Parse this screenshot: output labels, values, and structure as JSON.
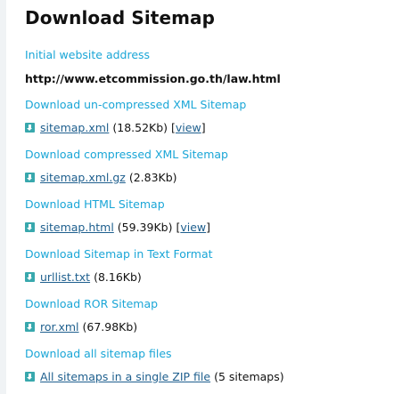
{
  "page": {
    "title": "Download Sitemap",
    "initial_label": "Initial website address",
    "initial_url": "http://www.etcommission.go.th/law.html"
  },
  "sections": [
    {
      "heading": "Download un-compressed XML Sitemap",
      "file": "sitemap.xml",
      "size": "(18.52Kb)",
      "view_open": "[",
      "view_label": "view",
      "view_close": "]"
    },
    {
      "heading": "Download compressed XML Sitemap",
      "file": "sitemap.xml.gz",
      "size": "(2.83Kb)"
    },
    {
      "heading": "Download HTML Sitemap",
      "file": "sitemap.html",
      "size": "(59.39Kb)",
      "view_open": "[",
      "view_label": "view",
      "view_close": "]"
    },
    {
      "heading": "Download Sitemap in Text Format",
      "file": "urllist.txt",
      "size": "(8.16Kb)"
    },
    {
      "heading": "Download ROR Sitemap",
      "file": "ror.xml",
      "size": "(67.98Kb)"
    },
    {
      "heading": "Download all sitemap files",
      "file": "All sitemaps in a single ZIP file",
      "size": "(5 sitemaps)"
    }
  ],
  "icons": {
    "download": "download-icon"
  },
  "colors": {
    "heading_blue": "#1aa6d7",
    "link_blue": "#1e5f8e",
    "icon_teal": "#38a8ad",
    "text_dark": "#111111"
  }
}
